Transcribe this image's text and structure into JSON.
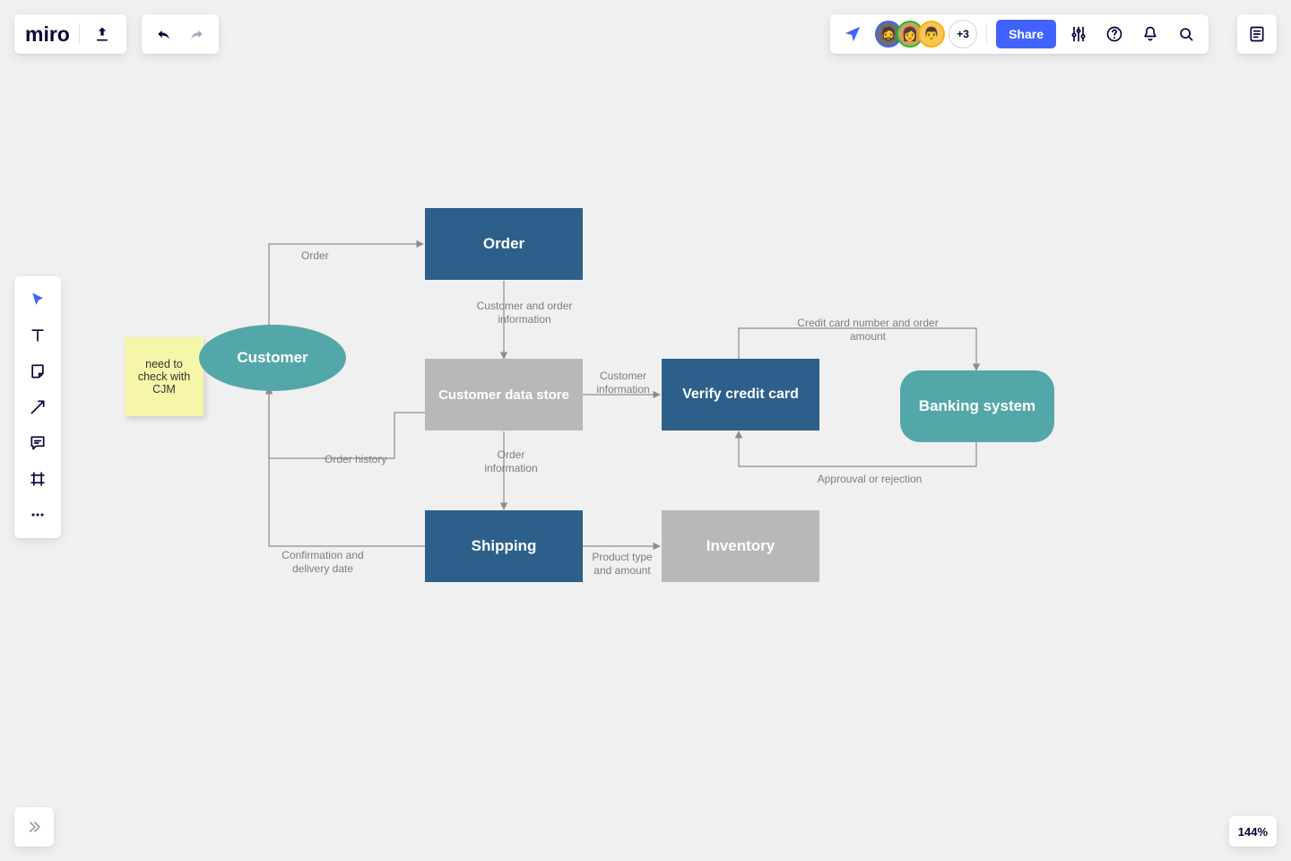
{
  "app": {
    "logo": "miro"
  },
  "topbar": {
    "share_label": "Share",
    "avatar_overflow": "+3",
    "avatars": [
      {
        "bg": "#6e6e6e",
        "ring": "#4262ff",
        "emoji": "🧔"
      },
      {
        "bg": "#d39b6a",
        "ring": "#17c615",
        "emoji": "👩"
      },
      {
        "bg": "#f2c75c",
        "ring": "#ffb000",
        "emoji": "👨"
      }
    ]
  },
  "zoom": {
    "label": "144%"
  },
  "sticky": {
    "text": "need to check with CJM"
  },
  "nodes": {
    "customer": "Customer",
    "order": "Order",
    "cds": "Customer data store",
    "shipping": "Shipping",
    "verify": "Verify credit card",
    "inventory": "Inventory",
    "bank": "Banking system"
  },
  "edges": {
    "e1": "Order",
    "e2": "Customer and order information",
    "e3": "Customer information",
    "e4": "Order information",
    "e5": "Order history",
    "e6": "Confirmation and delivery date",
    "e7": "Product type and amount",
    "e8": "Credit card number and order amount",
    "e9": "Approuval or rejection"
  }
}
